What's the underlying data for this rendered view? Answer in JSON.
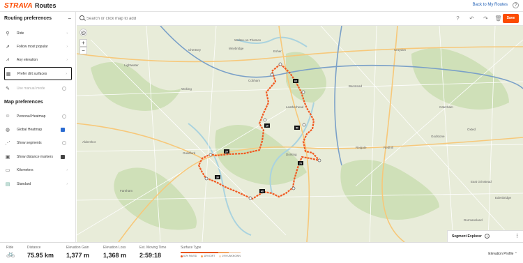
{
  "header": {
    "logo": "STRAVA",
    "title": "Routes",
    "back_link": "Back to My Routes"
  },
  "sidebar": {
    "routing_title": "Routing preferences",
    "routing": [
      {
        "label": "Ride",
        "icon": "bike-icon"
      },
      {
        "label": "Follow most popular",
        "icon": "popular-icon"
      },
      {
        "label": "Any elevation",
        "icon": "elevation-icon"
      },
      {
        "label": "Prefer dirt surfaces",
        "icon": "surface-icon",
        "active": true
      },
      {
        "label": "Use manual mode",
        "icon": "manual-icon",
        "disabled": true
      }
    ],
    "map_title": "Map preferences",
    "map": [
      {
        "label": "Personal Heatmap",
        "icon": "person-icon",
        "control": "toggle"
      },
      {
        "label": "Global Heatmap",
        "icon": "globe-icon",
        "control": "checked-blue"
      },
      {
        "label": "Show segments",
        "icon": "segments-icon",
        "control": "toggle"
      },
      {
        "label": "Show distance markers",
        "icon": "markers-icon",
        "control": "checked-dark"
      },
      {
        "label": "Kilometers",
        "icon": "ruler-icon",
        "control": "chevron"
      },
      {
        "label": "Standard",
        "icon": "map-style-icon",
        "control": "chevron"
      }
    ]
  },
  "search": {
    "placeholder": "Search or click map to add"
  },
  "toolbar": {
    "save_label": "Save"
  },
  "map": {
    "distance_markers": [
      "10",
      "20",
      "30",
      "40",
      "50",
      "60",
      "70"
    ],
    "place_labels": [
      "Weybridge",
      "Esher",
      "Cobham",
      "Lightwater",
      "Woking",
      "Leatherhead",
      "Guildford",
      "Dorking",
      "Aldershot",
      "Reigate",
      "Redhill",
      "Croydon",
      "Chertsey",
      "Walton-on-Thames",
      "Banstead",
      "Farnham",
      "East Grinstead",
      "Dormansland",
      "Edenbridge",
      "Godstone",
      "Oxted",
      "Caterham"
    ]
  },
  "segment_explorer": {
    "label": "Segment Explorer"
  },
  "stats": {
    "sport_label": "Ride",
    "distance_label": "Distance",
    "distance": "75.95 km",
    "gain_label": "Elevation Gain",
    "gain": "1,377 m",
    "loss_label": "Elevation Loss",
    "loss": "1,368 m",
    "time_label": "Est. Moving Time",
    "time": "2:59:18",
    "surface_label": "Surface Type",
    "surface": [
      {
        "label": "61% PAVED",
        "pct": 61,
        "color": "#e8571f"
      },
      {
        "label": "18% DIRT",
        "pct": 18,
        "color": "#f4a460"
      },
      {
        "label": "19% UNKNOWN",
        "pct": 19,
        "color": "#f3d9c2"
      }
    ],
    "elevation_profile": "Elevation Profile"
  },
  "colors": {
    "accent": "#fc4c02",
    "route": "#f15a22",
    "water": "#aad3df",
    "road": "#f7c87a"
  }
}
